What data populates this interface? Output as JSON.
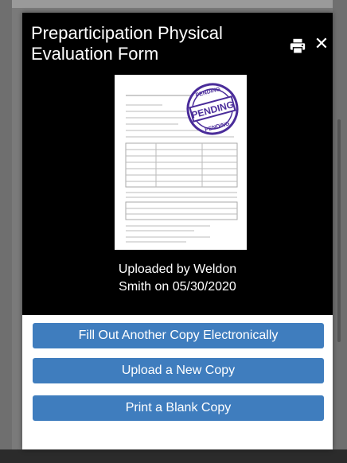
{
  "modal": {
    "title": "Preparticipation Physical Evaluation Form",
    "caption_line1": "Uploaded by Weldon",
    "caption_line2": "Smith on 05/30/2020",
    "stamp_text": "PENDING",
    "icons": {
      "print": "print-icon",
      "close": "close-icon"
    },
    "buttons": [
      {
        "label": "Fill Out Another Copy Electronically"
      },
      {
        "label": "Upload a New Copy"
      },
      {
        "label": "Print a Blank Copy"
      }
    ]
  },
  "colors": {
    "header_bg": "#000000",
    "button_bg": "#3f7dbe",
    "stamp": "#4a2c9a"
  }
}
